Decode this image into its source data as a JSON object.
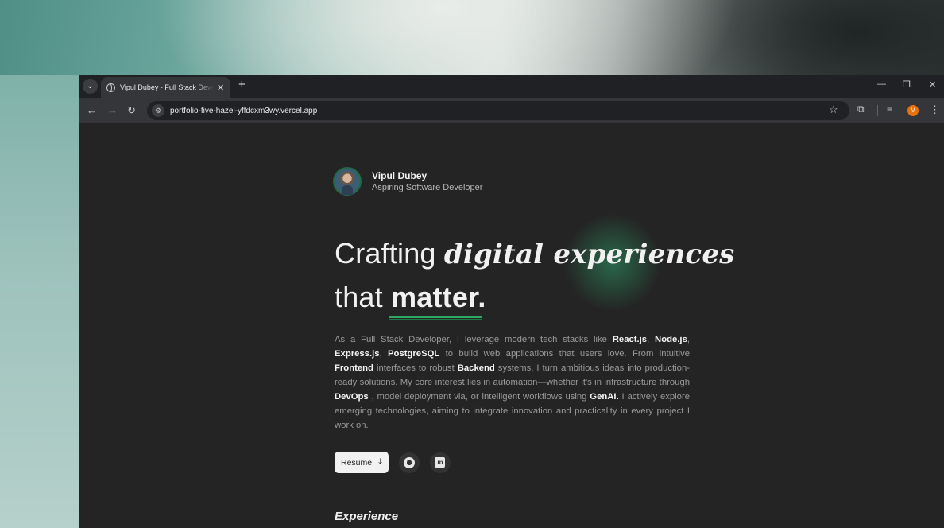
{
  "browser": {
    "tab_title": "Vipul Dubey - Full Stack Developer",
    "url": "portfolio-five-hazel-yffdcxm3wy.vercel.app",
    "profile_initial": "V"
  },
  "profile": {
    "name": "Vipul Dubey",
    "role": "Aspiring Software Developer"
  },
  "hero": {
    "line1_plain": "Crafting ",
    "line1_emphasis": "digital experiences",
    "line2_plain": "that ",
    "line2_emphasis": "matter."
  },
  "bio": {
    "p1": "As a Full Stack Developer, I leverage modern tech stacks like ",
    "t1": "React.js",
    "p2": ", ",
    "t2": "Node.js",
    "p3": ", ",
    "t3": "Express.js",
    "p4": ", ",
    "t4": "PostgreSQL",
    "p5": " to build web applications that users love. From intuitive ",
    "t5": "Frontend",
    "p6": " interfaces to robust ",
    "t6": "Backend",
    "p7": " systems, I turn ambitious ideas into production-ready solutions. My core interest lies in automation—whether it's in infrastructure through ",
    "t7": "DevOps",
    "p8": " , model deployment via, or intelligent workflows using ",
    "t8": "GenAI.",
    "p9": " I actively explore emerging technologies, aiming to integrate innovation and practicality in every project I work on."
  },
  "actions": {
    "resume_label": "Resume",
    "github_label": "GitHub",
    "linkedin_label": "in"
  },
  "sections": {
    "experience_title": "Experience"
  },
  "colors": {
    "accent_green": "#2fa866",
    "page_bg": "#242424"
  }
}
